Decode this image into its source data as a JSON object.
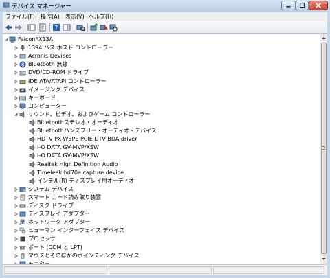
{
  "window": {
    "title": "デバイス マネージャー"
  },
  "menu": [
    {
      "label": "ファイル(F)"
    },
    {
      "label": "操作(A)"
    },
    {
      "label": "表示(V)"
    },
    {
      "label": "ヘルプ(H)"
    }
  ],
  "toolbar": [
    {
      "name": "back-icon"
    },
    {
      "name": "forward-icon"
    },
    {
      "name": "show-hide-console-tree-icon"
    },
    {
      "name": "properties-icon"
    },
    {
      "name": "help-icon"
    },
    {
      "name": "action-pane-icon"
    },
    {
      "name": "scan-hardware-changes-icon"
    },
    {
      "name": "update-driver-icon"
    },
    {
      "name": "uninstall-icon"
    },
    {
      "name": "disable-device-icon"
    }
  ],
  "tree": [
    {
      "label": "FalconFX13A",
      "icon": "computer-icon",
      "expander": "expanded",
      "level": 0
    },
    {
      "label": "1394 バス ホスト コントローラー",
      "icon": "1394-controller-icon",
      "expander": "collapsed",
      "level": 1
    },
    {
      "label": "Acronis Devices",
      "icon": "device-icon",
      "expander": "collapsed",
      "level": 1
    },
    {
      "label": "Bluetooth 無線",
      "icon": "bluetooth-icon",
      "expander": "collapsed",
      "level": 1
    },
    {
      "label": "DVD/CD-ROM ドライブ",
      "icon": "dvd-drive-icon",
      "expander": "collapsed",
      "level": 1
    },
    {
      "label": "IDE ATA/ATAPI コントローラー",
      "icon": "ide-controller-icon",
      "expander": "collapsed",
      "level": 1
    },
    {
      "label": "イメージング デバイス",
      "icon": "imaging-device-icon",
      "expander": "collapsed",
      "level": 1
    },
    {
      "label": "キーボード",
      "icon": "keyboard-icon",
      "expander": "collapsed",
      "level": 1
    },
    {
      "label": "コンピューター",
      "icon": "computer-icon",
      "expander": "collapsed",
      "level": 1
    },
    {
      "label": "サウンド、ビデオ、およびゲーム コントローラー",
      "icon": "speaker-icon",
      "expander": "expanded",
      "level": 1
    },
    {
      "label": "Bluetoothステレオ・オーディオ",
      "icon": "speaker-icon",
      "expander": "none",
      "level": 2
    },
    {
      "label": "Bluetoothハンズフリー・オーディオ・デバイス",
      "icon": "speaker-icon",
      "expander": "none",
      "level": 2
    },
    {
      "label": "HDTV PX-W3PE PCIE DTV BDA driver",
      "icon": "speaker-icon",
      "expander": "none",
      "level": 2
    },
    {
      "label": "I-O DATA GV-MVP/XSW",
      "icon": "speaker-icon",
      "expander": "none",
      "level": 2
    },
    {
      "label": "I-O DATA GV-MVP/XSW",
      "icon": "speaker-icon",
      "expander": "none",
      "level": 2
    },
    {
      "label": "Realtek High Definition Audio",
      "icon": "speaker-icon",
      "expander": "none",
      "level": 2
    },
    {
      "label": "Timeleak hd70a capture device",
      "icon": "speaker-icon",
      "expander": "none",
      "level": 2
    },
    {
      "label": "インテル(R) ディスプレイ用オーディオ",
      "icon": "speaker-icon",
      "expander": "none",
      "level": 2
    },
    {
      "label": "システム デバイス",
      "icon": "system-device-icon",
      "expander": "collapsed",
      "level": 1
    },
    {
      "label": "スマート カード読み取り装置",
      "icon": "smart-card-reader-icon",
      "expander": "collapsed",
      "level": 1
    },
    {
      "label": "ディスク ドライブ",
      "icon": "disk-drive-icon",
      "expander": "collapsed",
      "level": 1
    },
    {
      "label": "ディスプレイ アダプター",
      "icon": "display-adapter-icon",
      "expander": "collapsed",
      "level": 1
    },
    {
      "label": "ネットワーク アダプター",
      "icon": "network-adapter-icon",
      "expander": "collapsed",
      "level": 1
    },
    {
      "label": "ヒューマン インターフェイス デバイス",
      "icon": "hid-icon",
      "expander": "collapsed",
      "level": 1
    },
    {
      "label": "プロセッサ",
      "icon": "processor-icon",
      "expander": "collapsed",
      "level": 1
    },
    {
      "label": "ポート (COM と LPT)",
      "icon": "port-icon",
      "expander": "collapsed",
      "level": 1
    },
    {
      "label": "マウスとそのほかのポインティング デバイス",
      "icon": "mouse-icon",
      "expander": "collapsed",
      "level": 1
    },
    {
      "label": "モニター",
      "icon": "monitor-icon",
      "expander": "collapsed",
      "level": 1
    }
  ],
  "colors": {
    "window_frame": "#c6d8e8",
    "close_button": "#c24330",
    "tree_background": "#ffffff"
  }
}
